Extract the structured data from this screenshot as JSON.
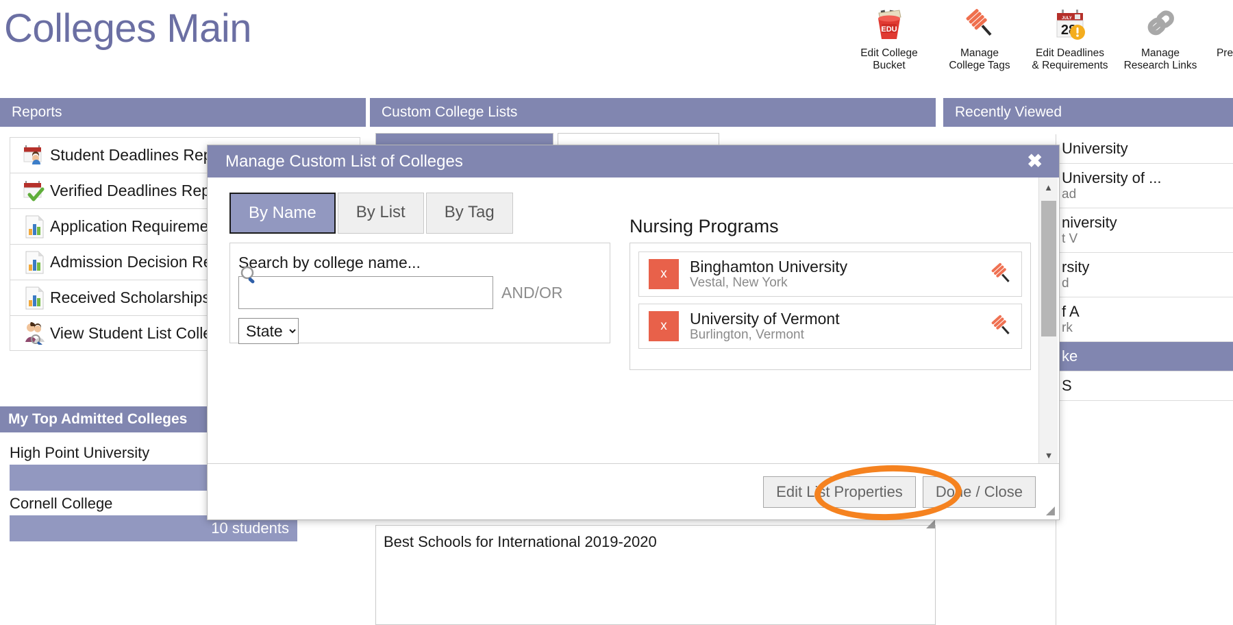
{
  "header": {
    "title": "Colleges Main",
    "toolbar": [
      {
        "icon": "bucket-edu-icon",
        "label": "Edit College\nBucket"
      },
      {
        "icon": "pin-tag-icon",
        "label": "Manage\nCollege Tags"
      },
      {
        "icon": "calendar-alert-icon",
        "label": "Edit Deadlines\n& Requirements"
      },
      {
        "icon": "chain-link-icon",
        "label": "Manage\nResearch Links"
      },
      {
        "icon": "partial-icon",
        "label": "Pre"
      }
    ]
  },
  "panels": {
    "reports_header": "Reports",
    "custom_lists_header": "Custom College Lists",
    "recently_viewed_header": "Recently Viewed"
  },
  "reports": [
    {
      "icon": "calendar-student-icon",
      "label": "Student Deadlines Report"
    },
    {
      "icon": "calendar-check-icon",
      "label": "Verified Deadlines Report"
    },
    {
      "icon": "bar-chart-doc-icon",
      "label": "Application Requirements"
    },
    {
      "icon": "bar-chart-doc-icon",
      "label": "Admission Decision Report"
    },
    {
      "icon": "bar-chart-doc-icon",
      "label": "Received Scholarships Report"
    },
    {
      "icon": "students-search-icon",
      "label": "View Student List College"
    }
  ],
  "admitted": {
    "header": "My Top Admitted Colleges",
    "bars": [
      {
        "label": "High Point University",
        "value": ""
      },
      {
        "label": "Cornell College",
        "value": "10 students"
      }
    ]
  },
  "custom_lists": {
    "bottom_item": "Best Schools for International 2019-2020"
  },
  "recently_viewed": [
    {
      "name": "University",
      "sub": ""
    },
    {
      "name": "University of ...",
      "sub": "ad"
    },
    {
      "name": "niversity",
      "sub": "t V"
    },
    {
      "name": "rsity",
      "sub": "d"
    },
    {
      "name": "f A",
      "sub": "rk"
    },
    {
      "name": "ke",
      "sub": ""
    },
    {
      "name": "S",
      "sub": ""
    }
  ],
  "modal": {
    "title": "Manage Custom List of Colleges",
    "close_icon": "close-icon",
    "tabs": [
      {
        "label": "By Name",
        "active": true
      },
      {
        "label": "By List",
        "active": false
      },
      {
        "label": "By Tag",
        "active": false
      }
    ],
    "search": {
      "label": "Search by college name...",
      "value": "",
      "placeholder": "",
      "icon": "search-icon",
      "andor": "AND/OR",
      "state_select": "State"
    },
    "list": {
      "title": "Nursing Programs",
      "colleges": [
        {
          "remove": "x",
          "name": "Binghamton University",
          "city": "Vestal, New York",
          "pin": "pin-icon"
        },
        {
          "remove": "x",
          "name": "University of Vermont",
          "city": "Burlington, Vermont",
          "pin": "pin-icon"
        }
      ]
    },
    "footer": {
      "edit_properties": "Edit List Properties",
      "done_close": "Done / Close"
    }
  },
  "colors": {
    "brand_purple": "#8186b0",
    "title_purple": "#6b6fa3",
    "accent_orange": "#f5821f",
    "remove_red": "#e8614a"
  }
}
